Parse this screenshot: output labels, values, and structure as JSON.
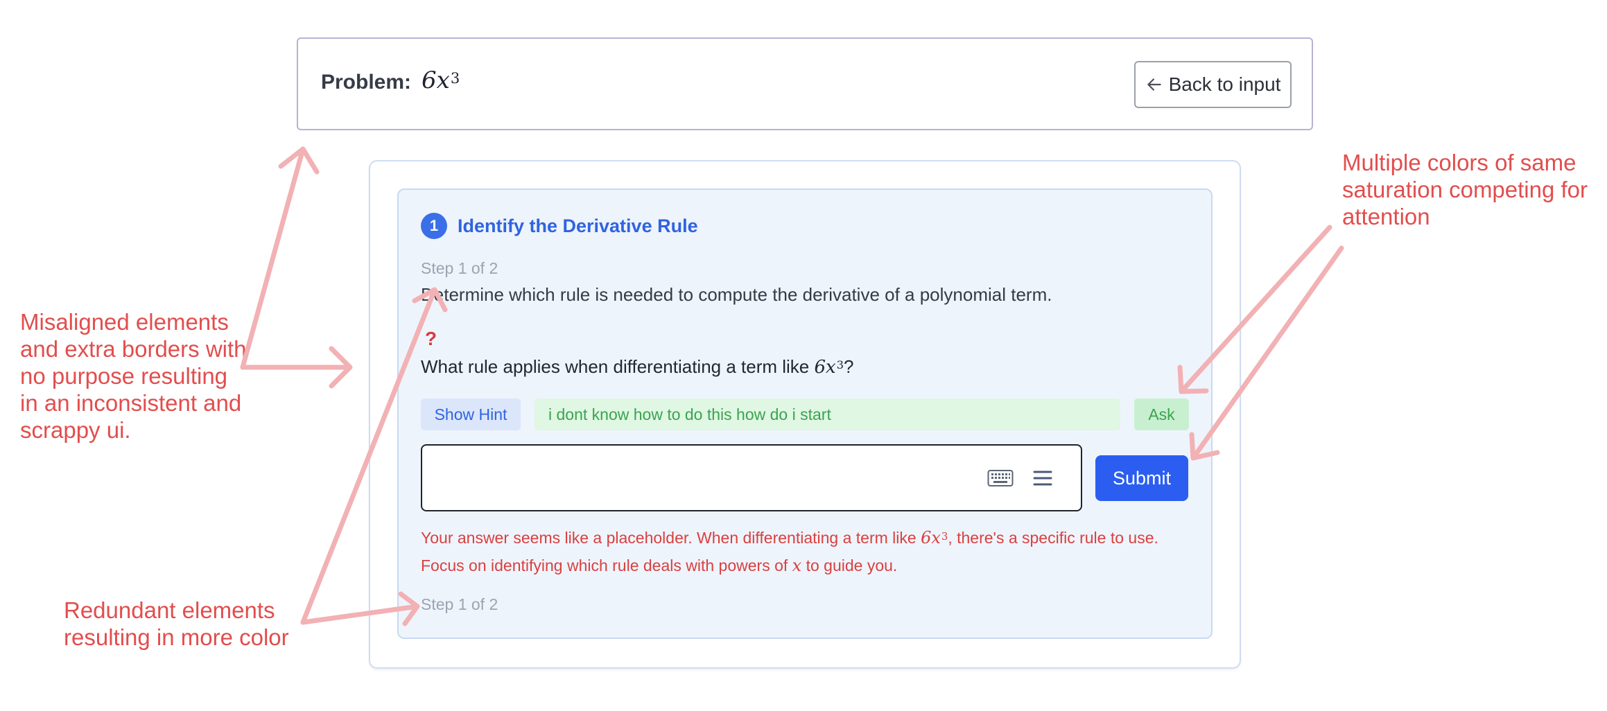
{
  "problem": {
    "label": "Problem:",
    "expression_base": "6x",
    "expression_exp": "3",
    "back_button": "Back to input"
  },
  "step": {
    "number": "1",
    "title": "Identify the Derivative Rule",
    "progress": "Step 1 of 2",
    "description": "Determine which rule is needed to compute the derivative of a polynomial term.",
    "question_mark": "?",
    "question_prefix": "What rule applies when differentiating a term like ",
    "question_math_base": "6x",
    "question_math_exp": "3",
    "question_suffix": "?",
    "hint_button": "Show Hint",
    "ask_value": "i dont know how to do this how do i start",
    "ask_button": "Ask",
    "answer_value": "",
    "submit_button": "Submit",
    "feedback_part1": "Your answer seems like a placeholder. When differentiating a term like ",
    "feedback_math_base": "6x",
    "feedback_math_exp": "3",
    "feedback_part2": ", there's a specific rule to use.",
    "feedback_line2_prefix": "Focus on identifying which rule deals with powers of ",
    "feedback_line2_var": "x",
    "feedback_line2_suffix": " to guide you.",
    "progress_bottom": "Step 1 of 2"
  },
  "annotations": {
    "left": "Misaligned elements and extra borders with no purpose resulting in an inconsistent and scrappy ui.",
    "right": "Multiple colors of same saturation competing for attention",
    "bottom": "Redundant elements resulting in more color"
  },
  "colors": {
    "accent": "#2b5ef0",
    "title_blue": "#2f63e0",
    "error_red": "#d94040",
    "annotation_red": "#e24d4d",
    "ask_green": "#3ba34f",
    "arrow_pink": "#f2b1b4"
  },
  "icons": [
    "arrow-left-icon",
    "keyboard-icon",
    "menu-icon"
  ]
}
